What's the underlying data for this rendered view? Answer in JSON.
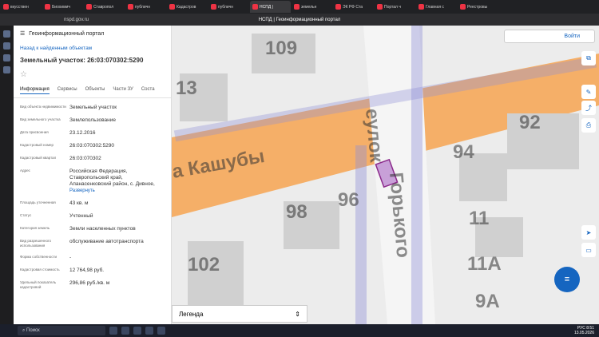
{
  "browser": {
    "tabs": [
      {
        "label": "вкусствен"
      },
      {
        "label": "Биохимич"
      },
      {
        "label": "Ставропол"
      },
      {
        "label": "публичн"
      },
      {
        "label": "Кадастров"
      },
      {
        "label": "публичн"
      },
      {
        "label": "НСПД |"
      },
      {
        "label": "земельн"
      },
      {
        "label": "ЭК РФ Ста"
      },
      {
        "label": "Портал ч"
      },
      {
        "label": "Главная с"
      },
      {
        "label": "Реестровы"
      }
    ],
    "url": "nspd.gov.ru",
    "title": "НСПД | Геоинформационный портал"
  },
  "panel": {
    "brand": "Геоинформационный портал",
    "back": "Назад к найденным объектам",
    "title": "Земельный участок: 26:03:070302:5290",
    "tabs": [
      "Информация",
      "Сервисы",
      "Объекты",
      "Части ЗУ",
      "Соста"
    ],
    "rows": [
      {
        "k": "Вид объекта недвижимости",
        "v": "Земельный участок"
      },
      {
        "k": "Вид земельного участка",
        "v": "Землепользование"
      },
      {
        "k": "Дата присвоения",
        "v": "23.12.2016"
      },
      {
        "k": "Кадастровый номер",
        "v": "26:03:070302:5290"
      },
      {
        "k": "Кадастровый квартал",
        "v": "26:03:070302"
      },
      {
        "k": "Адрес",
        "v": "Российская Федерация, Ставропольский край, Апанасенковский район, с. Дивное,"
      },
      {
        "k": "Площадь уточненная",
        "v": "43 кв. м"
      },
      {
        "k": "Статус",
        "v": "Учтенный"
      },
      {
        "k": "Категория земель",
        "v": "Земли населенных пунктов"
      },
      {
        "k": "Вид разрешенного использования",
        "v": "обслуживание автотранспорта"
      },
      {
        "k": "Форма собственности",
        "v": "-"
      },
      {
        "k": "Кадастровая стоимость",
        "v": "12 764,98 руб."
      },
      {
        "k": "Удельный показатель кадастровой",
        "v": "296,86 руб./кв. м"
      }
    ],
    "expand": "Развернуть"
  },
  "map": {
    "login": "Войти",
    "legend": "Легенда",
    "street1": "а Кашубы",
    "street2": "Горького",
    "street3": "еулок",
    "numbers": [
      "109",
      "13",
      "92",
      "94",
      "96",
      "98",
      "11",
      "102",
      "11А",
      "9А"
    ]
  },
  "taskbar": {
    "search": "Поиск",
    "time": "8:51",
    "date": "13.05.2026",
    "lang": "РУС"
  }
}
